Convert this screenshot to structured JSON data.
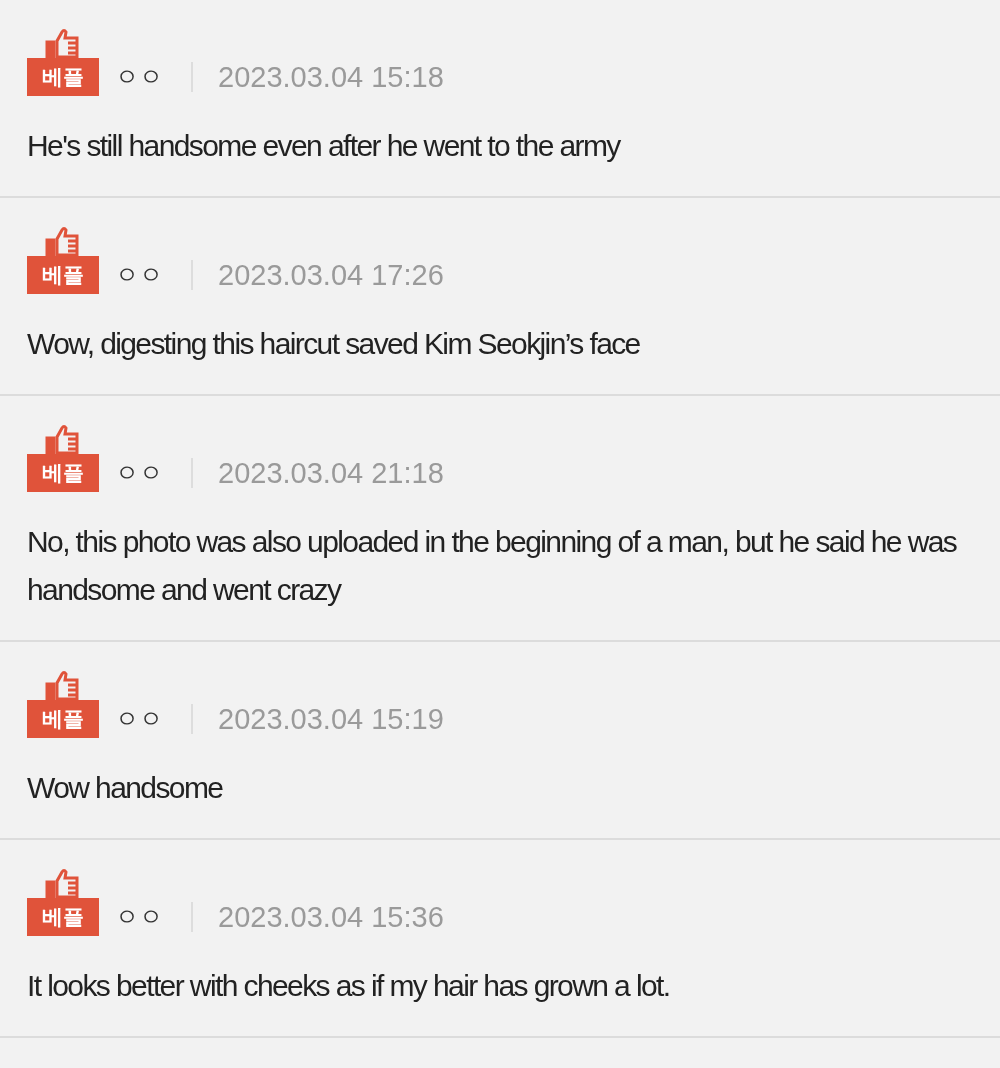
{
  "comments": [
    {
      "badge": "베플",
      "user": "ㅇㅇ",
      "date": "2023.03.04 15:18",
      "text": "He's still handsome even after he went to the army"
    },
    {
      "badge": "베플",
      "user": "ㅇㅇ",
      "date": "2023.03.04 17:26",
      "text": "Wow, digesting this haircut saved Kim Seokjin’s face"
    },
    {
      "badge": "베플",
      "user": "ㅇㅇ",
      "date": "2023.03.04 21:18",
      "text": "No, this photo was also uploaded in the beginning of a man, but he said he was handsome and went crazy"
    },
    {
      "badge": "베플",
      "user": "ㅇㅇ",
      "date": "2023.03.04 15:19",
      "text": "Wow handsome"
    },
    {
      "badge": "베플",
      "user": "ㅇㅇ",
      "date": "2023.03.04 15:36",
      "text": "It looks better with cheeks as if my hair has grown a lot."
    }
  ]
}
